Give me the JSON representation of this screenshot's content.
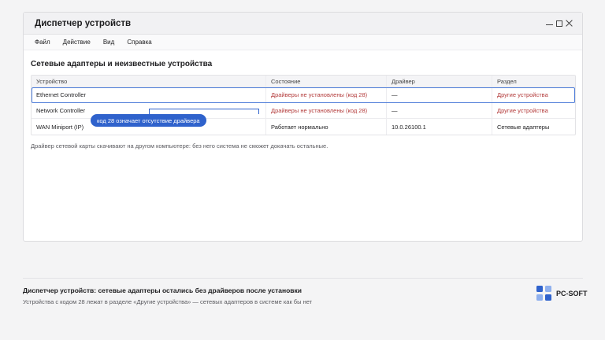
{
  "window": {
    "title": "Диспетчер устройств",
    "controls": [
      "minimize-icon",
      "maximize-icon",
      "close-icon"
    ]
  },
  "menu": [
    "Файл",
    "Действие",
    "Вид",
    "Справка"
  ],
  "section_title": "Сетевые адаптеры и неизвестные устройства",
  "table": {
    "headers": [
      "Устройство",
      "Состояние",
      "Драйвер",
      "Раздел"
    ],
    "rows": [
      [
        "Ethernet Controller",
        "Драйверы не установлены (код 28)",
        "—",
        "Другие устройства"
      ],
      [
        "Network Controller",
        "Драйверы не установлены (код 28)",
        "—",
        "Другие устройства"
      ],
      [
        "WAN Miniport (IP)",
        "Работает нормально",
        "10.0.26100.1",
        "Сетевые адаптеры"
      ]
    ],
    "selected_row": 0
  },
  "callout": "код 28 означает отсутствие драйвера",
  "hint": "Драйвер сетевой карты скачивают на другом компьютере: без него система не сможет докачать остальные.",
  "caption": "Диспетчер устройств: сетевые адаптеры остались без драйверов после установки",
  "subcaption": "Устройства с кодом 28 лежат в разделе «Другие устройства» — сетевых адаптеров в системе как бы нет",
  "brand": {
    "name": "PC-SOFT",
    "logo_colors": [
      "#2f62cc",
      "#8fb0ee",
      "#8fb0ee",
      "#2f62cc"
    ]
  },
  "colors": {
    "accent": "#2f62cc",
    "error": "#b33a3a",
    "selection": "#4b7bd8"
  }
}
